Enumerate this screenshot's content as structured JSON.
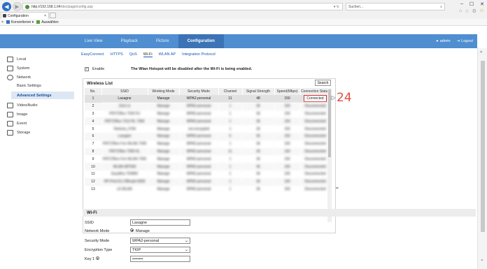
{
  "browser": {
    "url_host": "http://192.168.1.64",
    "url_path": "/doc/page/config.asp",
    "url_controls": "▾ ↻",
    "search_placeholder": "Suchen...",
    "tab_title": "Configuration",
    "fav_convert": "Konvertieren",
    "fav_select": "Auswählen",
    "window_controls": [
      "–",
      "☐",
      "✕"
    ]
  },
  "header": {
    "nav": [
      "Live View",
      "Playback",
      "Picture",
      "Configuration"
    ],
    "active_nav": "Configuration",
    "user": "admin",
    "logout": "Logout"
  },
  "sidebar": {
    "items": [
      {
        "label": "Local",
        "icon": "monitor-icon"
      },
      {
        "label": "System",
        "icon": "system-icon"
      },
      {
        "label": "Network",
        "icon": "network-icon"
      },
      {
        "label": "Video/Audio",
        "icon": "video-audio-icon"
      },
      {
        "label": "Image",
        "icon": "image-icon"
      },
      {
        "label": "Event",
        "icon": "event-icon"
      },
      {
        "label": "Storage",
        "icon": "storage-icon"
      }
    ],
    "sub_items": [
      "Basic Settings",
      "Advanced Settings"
    ],
    "active_sub": "Advanced Settings"
  },
  "subtabs": [
    "EasyConnect",
    "HTTPS",
    "QoS",
    "Wi-Fi",
    "WLAN AP",
    "Integration Protocol"
  ],
  "active_subtab": "Wi-Fi",
  "enable_label": "Enable",
  "enable_checked": "✓",
  "warning_text": "The Wlan Hotspot will be disabled after the Wi-Fi is being enabled.",
  "wireless_list": {
    "title": "Wireless List",
    "search_label": "Search",
    "headers": [
      "No.",
      "SSID",
      "Working Mode",
      "Security Mode",
      "Channel",
      "Signal Strength",
      "Speed(Mbps)",
      "Connection Status"
    ],
    "first_row": [
      "1",
      "Lasagne",
      "Manage",
      "WPA2-personal",
      "11",
      "48",
      "150",
      "Connected"
    ],
    "blurred_rows": [
      [
        "2",
        "Zimt Lit",
        "Manage",
        "WPA2-personal",
        "1",
        "36",
        "Disconnected"
      ],
      [
        "3",
        "FRITZ!Box 7530 RJ",
        "Manage",
        "WPA2-personal",
        "1",
        "36",
        "Disconnected"
      ],
      [
        "4",
        "FRITZ!Box 7312 RL 7360",
        "Manage",
        "WPA2-personal",
        "1",
        "36",
        "Disconnected"
      ],
      [
        "5",
        "Telekom_FON",
        "Manage",
        "not encrypted",
        "1",
        "36",
        "Disconnected"
      ],
      [
        "6",
        "Lasagne",
        "Manage",
        "WPA2-personal",
        "6",
        "36",
        "Disconnected"
      ],
      [
        "7",
        "FRITZ!Box Fon WLAN 7390",
        "Manage",
        "WPA2-personal",
        "1",
        "36",
        "Disconnected"
      ],
      [
        "8",
        "FRITZ!Box 7590 KL",
        "Manage",
        "WPA2-personal",
        "11",
        "36",
        "Disconnected"
      ],
      [
        "9",
        "FRITZ!Box Fon WLAN 7360",
        "Manage",
        "WPA2-personal",
        "1",
        "36",
        "Disconnected"
      ],
      [
        "10",
        "WLAN-987560",
        "Manage",
        "WPA2-personal",
        "1",
        "36",
        "Disconnected"
      ],
      [
        "11",
        "EasyBox-763860",
        "Manage",
        "WPA2-personal",
        "1",
        "36",
        "Disconnected"
      ],
      [
        "12",
        "HP-Print-E1-Officejet 6600",
        "Manage",
        "WPA2-personal",
        "1",
        "36",
        "Disconnected"
      ],
      [
        "13",
        "o2-WLAN",
        "Manage",
        "WPA2-personal",
        "1",
        "36",
        "Disconnected"
      ]
    ],
    "blurred_signal": "36",
    "blurred_speed": "150"
  },
  "overlay_number": "24",
  "wifi": {
    "section_title": "Wi-Fi",
    "ssid_label": "SSID",
    "ssid_value": "Lasagne",
    "network_mode_label": "Network Mode",
    "network_mode_value": "Manage",
    "security_mode_label": "Security Mode",
    "security_mode_value": "WPA2-personal",
    "encryption_label": "Encryption Type",
    "encryption_value": "TKIP",
    "key_label": "Key 1",
    "key_value": "••••••••"
  }
}
